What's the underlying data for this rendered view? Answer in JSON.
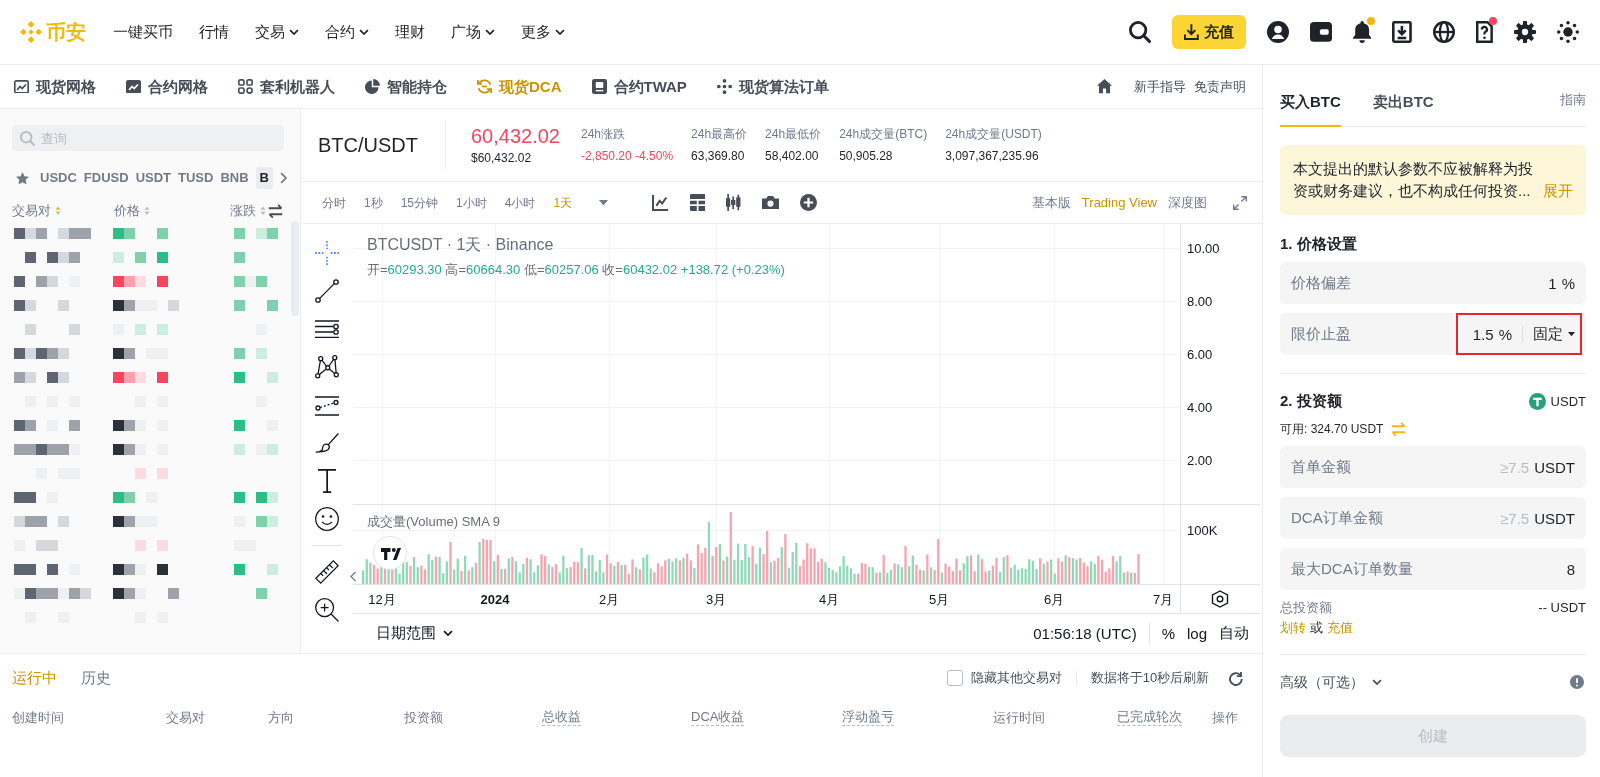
{
  "nav": {
    "brand": "币安",
    "items": [
      {
        "label": "一键买币",
        "dropdown": false
      },
      {
        "label": "行情",
        "dropdown": false
      },
      {
        "label": "交易",
        "dropdown": true
      },
      {
        "label": "合约",
        "dropdown": true
      },
      {
        "label": "理财",
        "dropdown": false
      },
      {
        "label": "广场",
        "dropdown": true
      },
      {
        "label": "更多",
        "dropdown": true
      }
    ],
    "actions": [
      {
        "kind": "search",
        "badge": false
      },
      {
        "kind": "deposit",
        "label": "充值",
        "badge": false
      },
      {
        "kind": "user",
        "badge": false
      },
      {
        "kind": "wallet",
        "badge": false
      },
      {
        "kind": "bell",
        "badge": true,
        "color": "#f0b90b"
      },
      {
        "kind": "tray",
        "badge": false
      },
      {
        "kind": "globe",
        "badge": false
      },
      {
        "kind": "help",
        "badge": true,
        "color": "#f6465d"
      },
      {
        "kind": "settings",
        "badge": false
      },
      {
        "kind": "theme",
        "badge": false
      }
    ]
  },
  "strategy_bar": {
    "tabs": [
      {
        "kind": "chart",
        "label": "现货网格",
        "selected": false
      },
      {
        "kind": "futures",
        "label": "合约网格",
        "selected": false
      },
      {
        "kind": "arbitrage",
        "label": "套利机器人",
        "selected": false
      },
      {
        "kind": "portfolio",
        "label": "智能持仓",
        "selected": false
      },
      {
        "kind": "dca",
        "label": "现货DCA",
        "selected": true
      },
      {
        "kind": "twap",
        "label": "合约TWAP",
        "selected": false
      },
      {
        "kind": "algo",
        "label": "现货算法订单",
        "selected": false
      }
    ],
    "links": [
      "新手指导",
      "免责声明"
    ]
  },
  "pair_list": {
    "search_placeholder": "查询",
    "quotes": [
      {
        "label": "USDC",
        "selected": false
      },
      {
        "label": "FDUSD",
        "selected": false
      },
      {
        "label": "USDT",
        "selected": false
      },
      {
        "label": "TUSD",
        "selected": false
      },
      {
        "label": "BNB",
        "selected": false
      },
      {
        "label": "B",
        "selected": true
      }
    ],
    "columns": [
      {
        "label": "交易对",
        "sorted": true
      },
      {
        "label": "价格",
        "sorted": false
      },
      {
        "label": "涨跌",
        "sorted": false
      }
    ],
    "pixelated": true
  },
  "ticker": {
    "pair": "BTC/USDT",
    "price": "60,432.02",
    "falling": true,
    "fiat_price": "$60,432.02",
    "stats": [
      {
        "label": "24h涨跌",
        "value": "-2,850.20 -4.50%",
        "negative": true
      },
      {
        "label": "24h最高价",
        "value": "63,369.80",
        "negative": false
      },
      {
        "label": "24h最低价",
        "value": "58,402.00",
        "negative": false
      },
      {
        "label": "24h成交量(BTC)",
        "value": "50,905.28",
        "negative": false
      },
      {
        "label": "24h成交量(USDT)",
        "value": "3,097,367,235.96",
        "negative": false
      }
    ]
  },
  "chart_toolbar": {
    "intervals": [
      {
        "label": "分时",
        "selected": false
      },
      {
        "label": "1秒",
        "selected": false
      },
      {
        "label": "15分钟",
        "selected": false
      },
      {
        "label": "1小时",
        "selected": false
      },
      {
        "label": "4小时",
        "selected": false
      },
      {
        "label": "1天",
        "selected": true
      }
    ],
    "tools": [
      {
        "kind": "indicators"
      },
      {
        "kind": "template"
      },
      {
        "kind": "candles"
      },
      {
        "kind": "camera"
      },
      {
        "kind": "add"
      }
    ],
    "views": [
      {
        "label": "基本版",
        "selected": false
      },
      {
        "label": "Trading View",
        "selected": true
      },
      {
        "label": "深度图",
        "selected": false
      }
    ]
  },
  "drawing_tools": [
    {
      "kind": "crosshair",
      "selected": true
    },
    {
      "kind": "trendline",
      "selected": false
    },
    {
      "kind": "lines",
      "selected": false
    },
    {
      "kind": "pattern",
      "selected": false
    },
    {
      "kind": "fibonacci",
      "selected": false
    },
    {
      "kind": "brush",
      "selected": false
    },
    {
      "kind": "text",
      "selected": false
    },
    {
      "kind": "emoji",
      "selected": false
    },
    {
      "kind": "ruler",
      "selected": false
    },
    {
      "kind": "zoom",
      "selected": false
    }
  ],
  "chart": {
    "title": "BTCUSDT · 1天 · Binance",
    "ohlc": [
      {
        "label": "开=",
        "value": "60293.30"
      },
      {
        "label": "高=",
        "value": "60664.30"
      },
      {
        "label": "低=",
        "value": "60257.06"
      },
      {
        "label": "收=",
        "value": "60432.02"
      }
    ],
    "change": "+138.72 (+0.23%)",
    "rising": true,
    "volume_label": "成交量(Volume) SMA 9",
    "price_ticks": [
      "10.00",
      "8.00",
      "6.00",
      "4.00",
      "2.00"
    ],
    "volume_ticks": [
      "100K"
    ],
    "time_ticks": [
      {
        "label": "12月",
        "kind": "month"
      },
      {
        "label": "2024",
        "kind": "year"
      },
      {
        "label": "2月",
        "kind": "month"
      },
      {
        "label": "3月",
        "kind": "month"
      },
      {
        "label": "4月",
        "kind": "month"
      },
      {
        "label": "5月",
        "kind": "month"
      },
      {
        "label": "6月",
        "kind": "month"
      },
      {
        "label": "7月",
        "kind": "month"
      }
    ],
    "date_range": "日期范围",
    "clock": "01:56:18 (UTC)",
    "scale_options": [
      "%",
      "log",
      "自动"
    ]
  },
  "orders": {
    "tabs": [
      {
        "label": "运行中",
        "selected": true
      },
      {
        "label": "历史",
        "selected": false
      }
    ],
    "hide_other_pairs": {
      "label": "隐藏其他交易对",
      "checked": false
    },
    "refresh_note": "数据将于10秒后刷新",
    "columns": [
      {
        "label": "创建时间",
        "hint": false
      },
      {
        "label": "交易对",
        "hint": false
      },
      {
        "label": "方向",
        "hint": false
      },
      {
        "label": "投资额",
        "hint": false
      },
      {
        "label": "总收益",
        "hint": true
      },
      {
        "label": "DCA收益",
        "hint": true
      },
      {
        "label": "浮动盈亏",
        "hint": true
      },
      {
        "label": "运行时间",
        "hint": false
      },
      {
        "label": "已完成轮次",
        "hint": true
      },
      {
        "label": "操作",
        "hint": false
      }
    ]
  },
  "order_form": {
    "tabs": [
      {
        "label": "买入BTC",
        "selected": true
      },
      {
        "label": "卖出BTC",
        "selected": false
      }
    ],
    "guide": "指南",
    "notice": {
      "text": "本文提出的默认参数不应被解释为投资或财务建议，也不构成任何投资...",
      "action": "展开"
    },
    "price_section": {
      "title": "1. 价格设置",
      "fields": [
        {
          "label": "价格偏差",
          "value": "1",
          "unit": "%",
          "highlighted": false
        },
        {
          "label": "限价止盈",
          "value": "1.5",
          "unit": "%",
          "mode": "固定",
          "highlighted": true
        }
      ]
    },
    "amount_section": {
      "title": "2. 投资额",
      "currency": "USDT",
      "available": "可用: 324.70 USDT",
      "fields": [
        {
          "label": "首单金额",
          "placeholder": "≥7.5",
          "unit": "USDT"
        },
        {
          "label": "DCA订单金额",
          "placeholder": "≥7.5",
          "unit": "USDT"
        },
        {
          "label": "最大DCA订单数量",
          "value": "8"
        }
      ],
      "total": {
        "label": "总投资额",
        "value": "-- USDT"
      },
      "links": [
        {
          "kind": "link",
          "label": "划转"
        },
        {
          "kind": "text",
          "label": "或"
        },
        {
          "kind": "link",
          "label": "充值"
        }
      ]
    },
    "advanced": {
      "label": "高级（可选）",
      "expanded": false
    },
    "submit": {
      "label": "创建",
      "disabled": true
    }
  }
}
